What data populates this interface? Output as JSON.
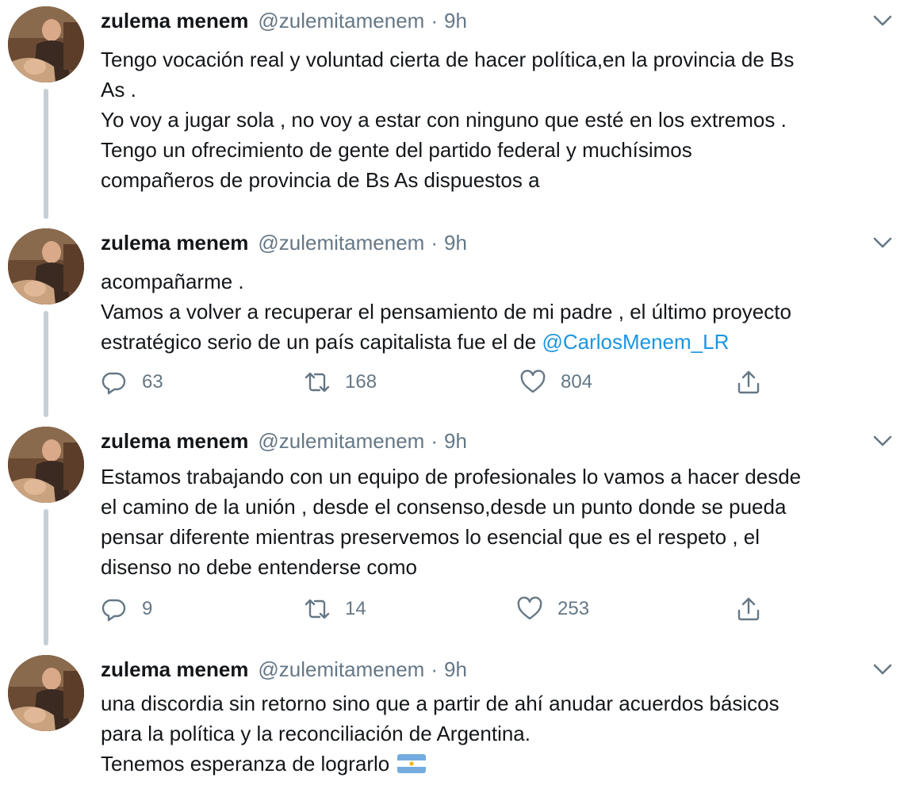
{
  "author": {
    "name": "zulema menem",
    "handle": "@zulemitamenem",
    "separator": "·",
    "time": "9h"
  },
  "tweets": [
    {
      "lines": [
        "Tengo vocación real y voluntad cierta de hacer política,en la provincia de Bs",
        "As .",
        "Yo voy a jugar sola , no voy a estar con ninguno que esté en los extremos .",
        "Tengo un ofrecimiento de gente del partido federal y muchísimos",
        "compañeros de provincia de Bs As  dispuestos a"
      ]
    },
    {
      "lines": [
        "acompañarme .",
        "Vamos a volver a recuperar el pensamiento de mi padre , el último proyecto"
      ],
      "last_line_prefix": "estratégico serio de un país capitalista fue el de ",
      "mention": "@CarlosMenem_LR",
      "counts": {
        "replies": "63",
        "retweets": "168",
        "likes": "804"
      }
    },
    {
      "lines": [
        "Estamos trabajando con un equipo de profesionales lo vamos a hacer desde",
        "el camino de la unión , desde el consenso,desde un punto donde se pueda",
        "pensar diferente mientras preservemos lo esencial que es el respeto , el",
        "disenso no debe entenderse como"
      ],
      "counts": {
        "replies": "9",
        "retweets": "14",
        "likes": "253"
      }
    },
    {
      "lines": [
        "una discordia sin retorno sino que a partir de ahí anudar acuerdos básicos",
        "para la política y la reconciliación de Argentina."
      ],
      "last_line": "Tenemos esperanza de lograrlo",
      "emoji": "argentina-flag"
    }
  ],
  "icons": {
    "reply": "reply-icon",
    "retweet": "retweet-icon",
    "like": "like-icon",
    "share": "share-icon",
    "caret": "chevron-down-icon"
  },
  "colors": {
    "text": "#14171a",
    "secondary": "#657786",
    "link": "#1b95e0",
    "thread_line": "#c4cfd6"
  }
}
